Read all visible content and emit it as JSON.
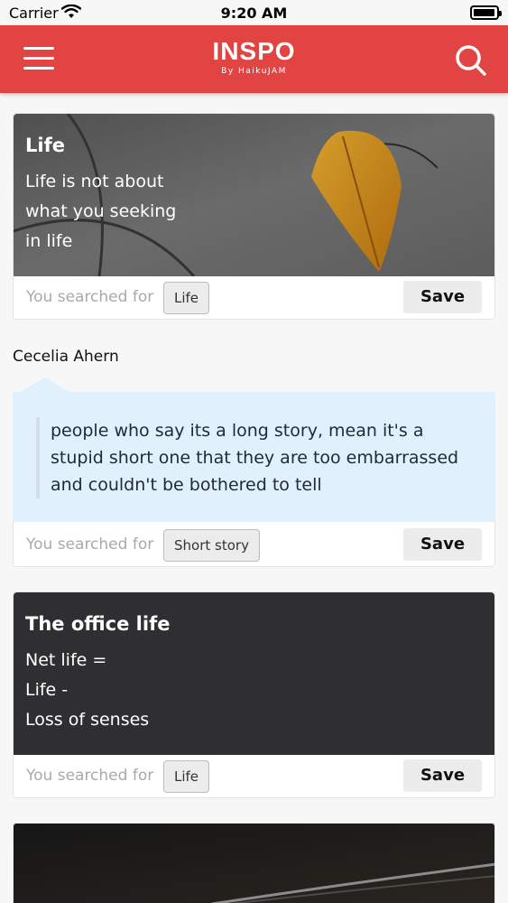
{
  "status_bar": {
    "carrier": "Carrier",
    "time": "9:20 AM"
  },
  "header": {
    "title": "INSPO",
    "subtitle": "By HaikuJAM"
  },
  "cards": [
    {
      "title": "Life",
      "body": [
        "Life is not about",
        "what you seeking",
        "in life"
      ],
      "searched_label": "You searched for",
      "tag": "Life",
      "save_label": "Save"
    },
    {
      "author": "Cecelia Ahern",
      "quote": "people who say its a long story, mean it's a stupid short one that they are too embarrassed and couldn't be bothered to tell",
      "searched_label": "You searched for",
      "tag": "Short story",
      "save_label": "Save"
    },
    {
      "title": "The office life",
      "body": [
        "Net life =",
        "Life -",
        "Loss of senses"
      ],
      "searched_label": "You searched for",
      "tag": "Life",
      "save_label": "Save"
    }
  ],
  "colors": {
    "brand": "#e24343",
    "quote_bg": "#e0f0fd",
    "dark_card": "#2f2f31"
  }
}
